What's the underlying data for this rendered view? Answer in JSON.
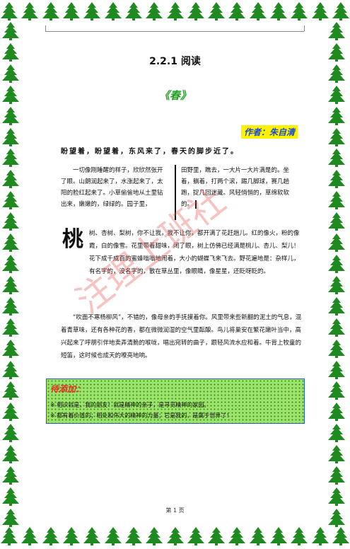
{
  "heading": "2.2.1 阅读",
  "subtitle": "《春》",
  "author": "作者：朱自清",
  "opening": "盼望着，盼望着，东风来了，春天的脚步近了。",
  "col_left": "一切像刚睡醒的样子，欣欣然张开了眼。山朗润起来了，水涨起来了，太阳的脸红起来了。小草偷偷地从土里钻出来，嫩嫩的，绿绿的。园子里，",
  "col_right": "田野里，瞧去，一大片一大片满是的。坐着，躺着，打两个滚，踢几脚球，赛几趟跑，捉几回迷藏。风轻悄悄的，草绵软软的。",
  "dropcap": "桃",
  "para1": "树、杏树、梨树，你不让我，我不让你，都开满了花赶趟儿。红的像火，粉的像霞，白的像雪。花里带着甜味，闭了眼，树上仿佛已经满是桃儿、杏儿、梨儿！花下成千成百的蜜蜂嗡嗡地闹着，大小的蝴蝶飞来飞去。野花遍地是：杂样儿，有名字的，没名字的，散在草丛里，像眼睛，像星星，还眨呀眨的。",
  "para2": "“吹面不寒杨柳风”，不错的，像母亲的手抚摸着你。风里带来些新翻的泥土的气息，混着青草味，还有各种花的香，都在微微润湿的空气里酝酿。鸟儿将巢安在繁花嫩叶当中，高兴起来了呼朋引伴地卖弄清脆的喉咙，唱出宛转的曲子，跟轻风流水应和着。牛背上牧童的短笛，这时候也成天的嘹亮地响。",
  "note": {
    "title": "待添加：",
    "line1": "※  相识就是，我的朋友！就是精神的亲子，是寻觅精神的家园。",
    "line2": "※  都有着价值的；相处和伟大的精神的力量；它是我的，是属于世界了！"
  },
  "watermark": "注理上班社",
  "footer": "第 1 页",
  "colors": {
    "tree": "#1f8a1f",
    "subtitle": "#22a022",
    "author_bg": "#fff200",
    "author_text": "#1a4ad1",
    "note_bg": "#9be36b",
    "note_title": "#e0301f"
  },
  "icons": {
    "border": "pine-tree-icon"
  }
}
